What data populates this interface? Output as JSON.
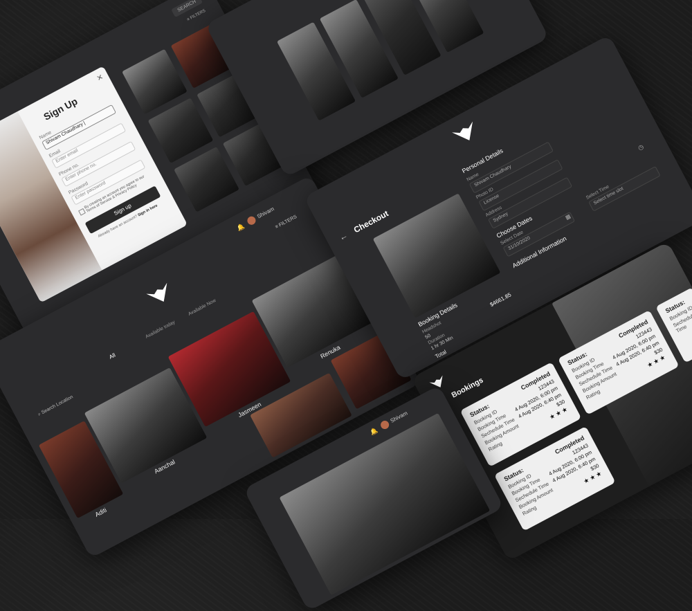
{
  "signup": {
    "title": "Sign Up",
    "close_label": "×",
    "name_label": "Name",
    "name_value": "Shivam Chaudhary |",
    "email_label": "Email",
    "email_placeholder": "Enter email",
    "phone_label": "Phone no.",
    "phone_placeholder": "Enter phone no.",
    "password_label": "Password",
    "password_placeholder": "Enter password",
    "terms_text": "By creating an account you agree to our Terms of Service & Privacy Policy",
    "button_label": "Sign up",
    "signin_text": "Already have an account?",
    "signin_link": "Sign in here",
    "filters_label": "FILTERS",
    "search_label": "SEARCH"
  },
  "header": {
    "user_name": "Shivam",
    "filters_label": "FILTERS"
  },
  "gallery": {
    "tabs": [
      "All",
      "Available today",
      "Available Now"
    ],
    "search_placeholder": "Search Location",
    "models": [
      "Renuka",
      "Jasmeen",
      "Aanchal",
      "Aditi"
    ]
  },
  "checkout": {
    "title": "Checkout",
    "personal_details": "Personal Details",
    "name_label": "Name",
    "name_value": "Shivam Chaudhary",
    "photo_id_label": "Photo ID",
    "license_value": "License",
    "address_label": "Address",
    "address_value": "Sydney",
    "choose_dates": "Choose Dates",
    "select_date_label": "Select Date",
    "date_value": "31/10/2020",
    "select_time_label": "Select Time",
    "time_placeholder": "Select time slot",
    "additional_info": "Additional Information",
    "booking_details": "Booking Details",
    "item_label": "Headshot",
    "duration_label": "Duration",
    "duration_value": "1 hr 30 Min",
    "item_qty": "50",
    "price": "$4661.85",
    "total_label": "Total"
  },
  "bookings": {
    "title": "Bookings",
    "cards": [
      {
        "status_label": "Status:",
        "status": "Completed",
        "booking_id_label": "Booking ID",
        "booking_id": "123443",
        "booking_time_label": "Booking Time",
        "booking_time": "4 Aug 2020, 6:00 pm",
        "schedule_time_label": "Sechedule Time",
        "schedule_time": "4 Aug 2020, 6:40 pm",
        "amount_label": "Booking Amount",
        "amount": "$30",
        "rating_label": "Rating",
        "rating": "★★★"
      },
      {
        "status_label": "Status:",
        "status": "Completed",
        "booking_id_label": "Booking ID",
        "booking_id": "123443",
        "booking_time_label": "Booking Time",
        "booking_time": "4 Aug 2020, 6:00 pm",
        "schedule_time_label": "Sechedule Time",
        "schedule_time": "4 Aug 2020, 6:40 pm",
        "amount_label": "Booking Amount",
        "amount": "$30",
        "rating_label": "Rating",
        "rating": "★★★"
      },
      {
        "status_label": "Status:",
        "status": "Completed",
        "booking_id_label": "Booking ID",
        "booking_id": "123443",
        "booking_time_label": "Booking Time",
        "booking_time": "4 Aug 2020, 6:00 pm",
        "schedule_time_label": "Sechedule Time",
        "schedule_time": "4 Aug 2020, 6:40 pm",
        "amount_label": "Booking Amount",
        "amount": "$30",
        "rating_label": "Rating",
        "rating": "★★★"
      },
      {
        "status_label": "Status:",
        "booking_id_label": "Booking ID",
        "schedule_time_label": "Sechedule Time"
      }
    ]
  },
  "bottom": {
    "user_name": "Shivam"
  }
}
